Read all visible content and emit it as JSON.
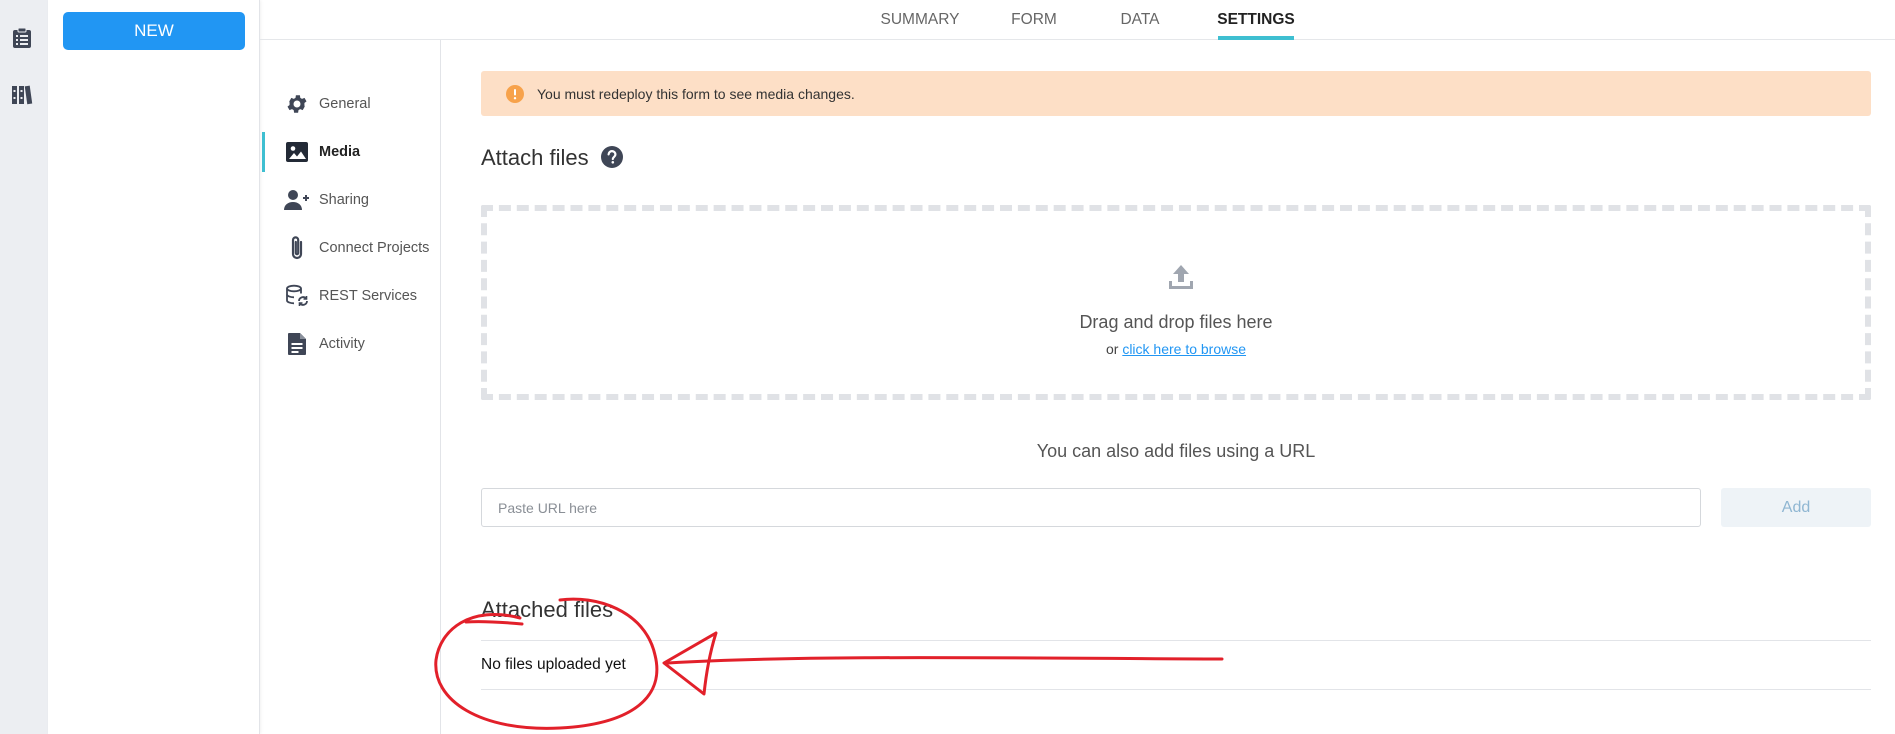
{
  "drawer": {
    "new_label": "NEW"
  },
  "tabs": [
    {
      "label": "SUMMARY",
      "active": false
    },
    {
      "label": "FORM",
      "active": false
    },
    {
      "label": "DATA",
      "active": false
    },
    {
      "label": "SETTINGS",
      "active": true
    }
  ],
  "subnav": [
    {
      "label": "General",
      "icon": "gear-icon"
    },
    {
      "label": "Media",
      "icon": "image-icon",
      "active": true
    },
    {
      "label": "Sharing",
      "icon": "user-plus-icon"
    },
    {
      "label": "Connect Projects",
      "icon": "paperclip-icon"
    },
    {
      "label": "REST Services",
      "icon": "database-sync-icon"
    },
    {
      "label": "Activity",
      "icon": "document-icon"
    }
  ],
  "alert": {
    "text": "You must redeploy this form to see media changes."
  },
  "attach": {
    "title": "Attach files",
    "drop_title": "Drag and drop files here",
    "drop_or": "or",
    "drop_link": "click here to browse"
  },
  "url": {
    "label": "You can also add files using a URL",
    "placeholder": "Paste URL here",
    "add_label": "Add"
  },
  "attached": {
    "title": "Attached files",
    "empty": "No files uploaded yet"
  },
  "colors": {
    "primary": "#2196f3",
    "accent": "#3ebfd1",
    "alert_bg": "#fddfc6",
    "alert_icon": "#f7a24b",
    "annotation": "#e2202a"
  }
}
